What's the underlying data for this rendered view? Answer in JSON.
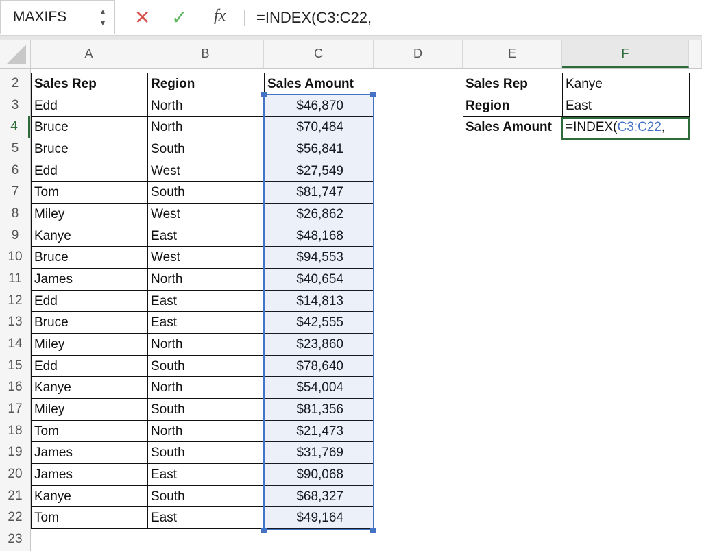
{
  "formula_bar": {
    "name_box": "MAXIFS",
    "cancel_icon": "✕",
    "enter_icon": "✓",
    "fx_label": "fx",
    "formula": "=INDEX(C3:C22,"
  },
  "columns": [
    "A",
    "B",
    "C",
    "D",
    "E",
    "F"
  ],
  "selected_column": "F",
  "row_numbers": [
    "2",
    "3",
    "4",
    "5",
    "6",
    "7",
    "8",
    "9",
    "10",
    "11",
    "12",
    "13",
    "14",
    "15",
    "16",
    "17",
    "18",
    "19",
    "20",
    "21",
    "22",
    "23"
  ],
  "selected_row": "4",
  "table": {
    "headers": [
      "Sales Rep",
      "Region",
      "Sales Amount"
    ],
    "rows": [
      [
        "Edd",
        "North",
        "$46,870"
      ],
      [
        "Bruce",
        "North",
        "$70,484"
      ],
      [
        "Bruce",
        "South",
        "$56,841"
      ],
      [
        "Edd",
        "West",
        "$27,549"
      ],
      [
        "Tom",
        "South",
        "$81,747"
      ],
      [
        "Miley",
        "West",
        "$26,862"
      ],
      [
        "Kanye",
        "East",
        "$48,168"
      ],
      [
        "Bruce",
        "West",
        "$94,553"
      ],
      [
        "James",
        "North",
        "$40,654"
      ],
      [
        "Edd",
        "East",
        "$14,813"
      ],
      [
        "Bruce",
        "East",
        "$42,555"
      ],
      [
        "Miley",
        "North",
        "$23,860"
      ],
      [
        "Edd",
        "South",
        "$78,640"
      ],
      [
        "Kanye",
        "North",
        "$54,004"
      ],
      [
        "Miley",
        "South",
        "$81,356"
      ],
      [
        "Tom",
        "North",
        "$21,473"
      ],
      [
        "James",
        "South",
        "$31,769"
      ],
      [
        "James",
        "East",
        "$90,068"
      ],
      [
        "Kanye",
        "South",
        "$68,327"
      ],
      [
        "Tom",
        "East",
        "$49,164"
      ]
    ]
  },
  "lookup": {
    "labels": [
      "Sales Rep",
      "Region",
      "Sales Amount"
    ],
    "values": [
      "Kanye",
      "East"
    ],
    "editing": {
      "prefix": "=INDEX(",
      "ref": "C3:C22",
      "suffix": ","
    }
  },
  "colors": {
    "range_highlight": "#4472c4",
    "active_cell": "#2e6b3a"
  }
}
